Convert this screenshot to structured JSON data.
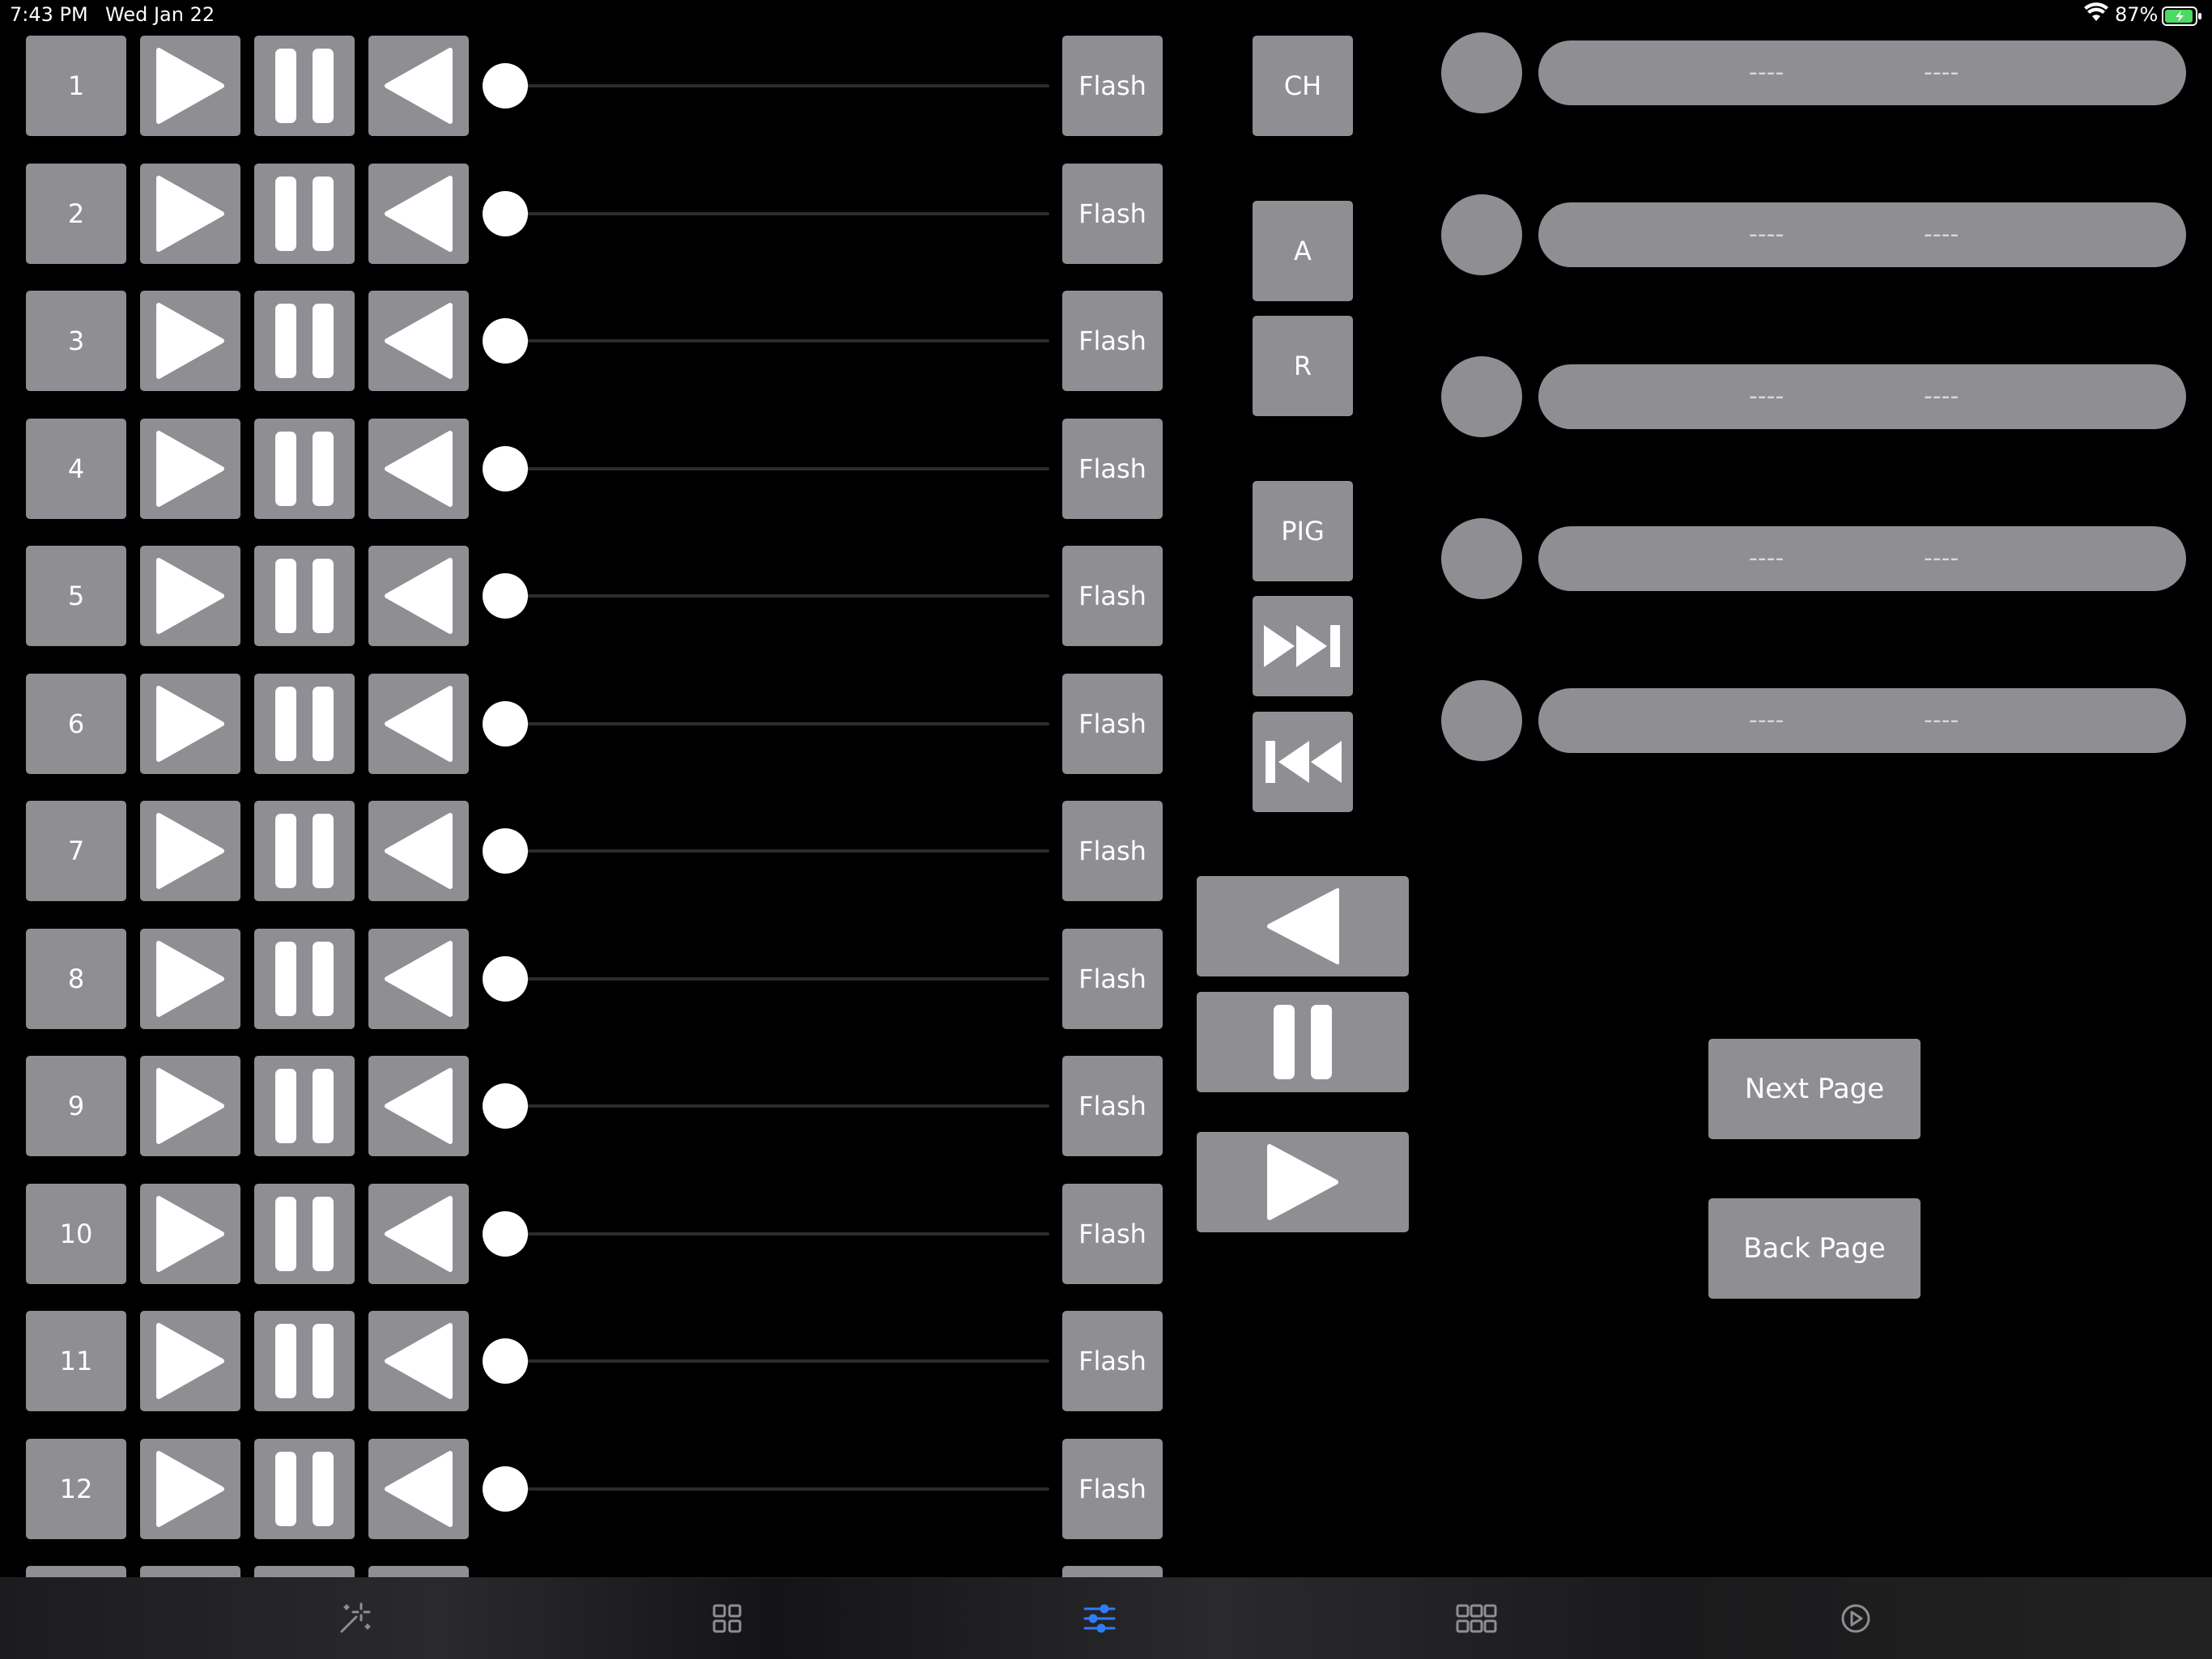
{
  "status": {
    "time": "7:43 PM",
    "date": "Wed Jan 22",
    "battery": "87%"
  },
  "colors": {
    "button": "#8e8e93",
    "accent": "#2f7cf6",
    "background": "#000000"
  },
  "playbacks": {
    "flash_label": "Flash",
    "rows": [
      {
        "number": "1",
        "level": 0
      },
      {
        "number": "2",
        "level": 0
      },
      {
        "number": "3",
        "level": 0
      },
      {
        "number": "4",
        "level": 0
      },
      {
        "number": "5",
        "level": 0
      },
      {
        "number": "6",
        "level": 0
      },
      {
        "number": "7",
        "level": 0
      },
      {
        "number": "8",
        "level": 0
      },
      {
        "number": "9",
        "level": 0
      },
      {
        "number": "10",
        "level": 0
      },
      {
        "number": "11",
        "level": 0
      },
      {
        "number": "12",
        "level": 0
      }
    ]
  },
  "side_buttons": {
    "ch": "CH",
    "a": "A",
    "r": "R",
    "pig": "PIG"
  },
  "info_rows": [
    {
      "left": "----",
      "right": "----"
    },
    {
      "left": "----",
      "right": "----"
    },
    {
      "left": "----",
      "right": "----"
    },
    {
      "left": "----",
      "right": "----"
    },
    {
      "left": "----",
      "right": "----"
    }
  ],
  "paging": {
    "next": "Next Page",
    "back": "Back Page"
  },
  "tabs": [
    {
      "icon": "magic-wand-icon",
      "active": false
    },
    {
      "icon": "grid-2x2-icon",
      "active": false
    },
    {
      "icon": "sliders-icon",
      "active": true
    },
    {
      "icon": "grid-3x2-icon",
      "active": false
    },
    {
      "icon": "settings-dial-icon",
      "active": false
    }
  ]
}
